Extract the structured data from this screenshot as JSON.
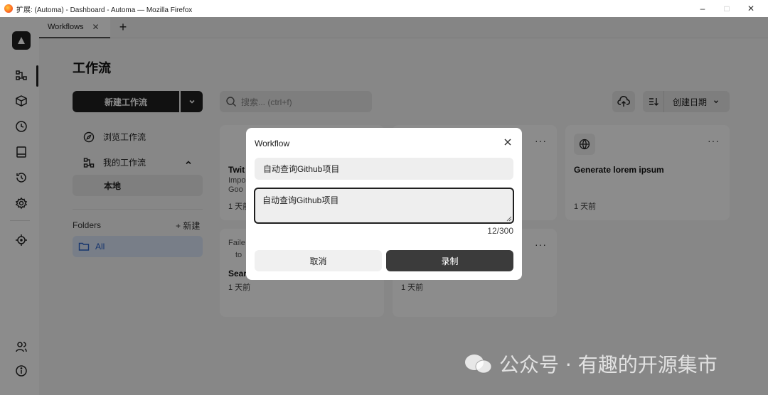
{
  "window": {
    "title": "扩展: (Automa) - Dashboard - Automa — Mozilla Firefox",
    "controls": [
      "–",
      "□",
      "✕"
    ]
  },
  "tabs": [
    {
      "label": "Workflows",
      "close": "✕"
    }
  ],
  "tab_add": "+",
  "page": {
    "title": "工作流",
    "new_workflow": "新建工作流",
    "nav": {
      "browse": "浏览工作流",
      "mine": "我的工作流",
      "local": "本地"
    },
    "folders": {
      "label": "Folders",
      "new": "+ 新建",
      "all": "All"
    },
    "search_placeholder": "搜索... (ctrl+f)",
    "sort_label": "创建日期"
  },
  "cards": [
    {
      "name": "Twit",
      "desc1": "Impo",
      "desc2": "Goo",
      "time": "1 天前"
    },
    {
      "name": "Sear",
      "desc1": "Faile",
      "desc2": "to",
      "time": "1 天前"
    },
    {
      "name": "",
      "time": "1 天前"
    },
    {
      "name": "Generate lorem ipsum",
      "time": "1 天前"
    }
  ],
  "more": "···",
  "modal": {
    "title": "Workflow",
    "name_value": "自动查询Github项目",
    "description_value": "自动查询Github项目",
    "char_count": "12/300",
    "cancel": "取消",
    "record": "录制"
  },
  "watermark": "公众号 · 有趣的开源集市",
  "colors": {
    "primary": "#1f1f1f",
    "folder_active_bg": "#dbe6f7",
    "folder_active_text": "#2a62c9",
    "record_button": "#3b3b3b"
  }
}
